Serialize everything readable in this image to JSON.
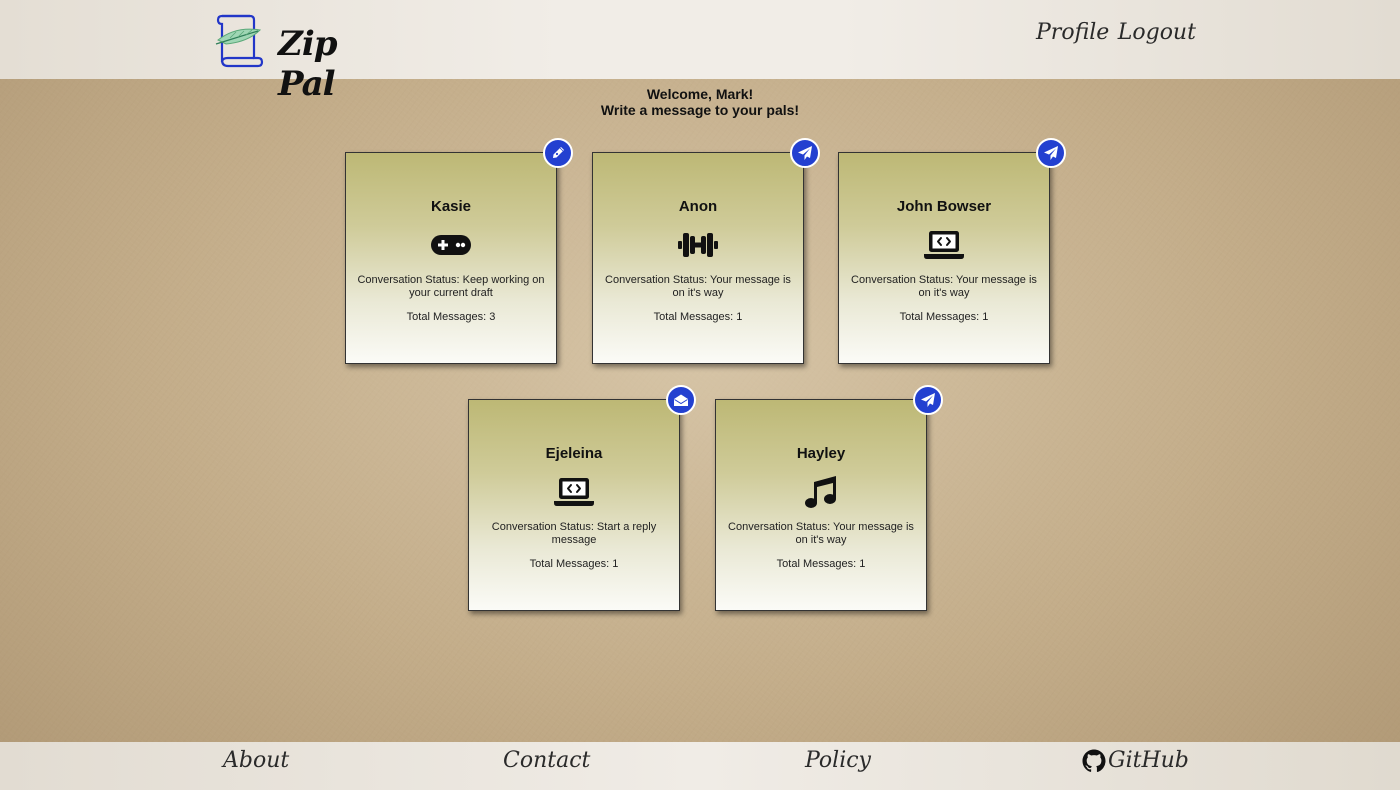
{
  "header": {
    "logo_text": "Zip Pal",
    "nav": {
      "profile": "Profile",
      "logout": "Logout"
    }
  },
  "welcome": {
    "line1": "Welcome, Mark!",
    "line2": "Write a message to your pals!"
  },
  "colors": {
    "badge": "#2340d0",
    "card_top": "#bdb875",
    "card_bottom": "#fbfbf7"
  },
  "pals": [
    {
      "name": "Kasie",
      "icon": "gamepad-icon",
      "badge_icon": "pen-icon",
      "status": "Conversation Status: Keep working on your current draft",
      "total": "Total Messages: 3"
    },
    {
      "name": "Anon",
      "icon": "dumbbell-icon",
      "badge_icon": "paper-plane-icon",
      "status": "Conversation Status: Your message is on it's way",
      "total": "Total Messages: 1"
    },
    {
      "name": "John Bowser",
      "icon": "laptop-code-icon",
      "badge_icon": "paper-plane-icon",
      "status": "Conversation Status: Your message is on it's way",
      "total": "Total Messages: 1"
    },
    {
      "name": "Ejeleina",
      "icon": "laptop-code-icon",
      "badge_icon": "envelope-open-icon",
      "status": "Conversation Status: Start a reply message",
      "total": "Total Messages: 1"
    },
    {
      "name": "Hayley",
      "icon": "music-icon",
      "badge_icon": "paper-plane-icon",
      "status": "Conversation Status: Your message is on it's way",
      "total": "Total Messages: 1"
    }
  ],
  "footer": {
    "about": "About",
    "contact": "Contact",
    "policy": "Policy",
    "github": "GitHub"
  }
}
